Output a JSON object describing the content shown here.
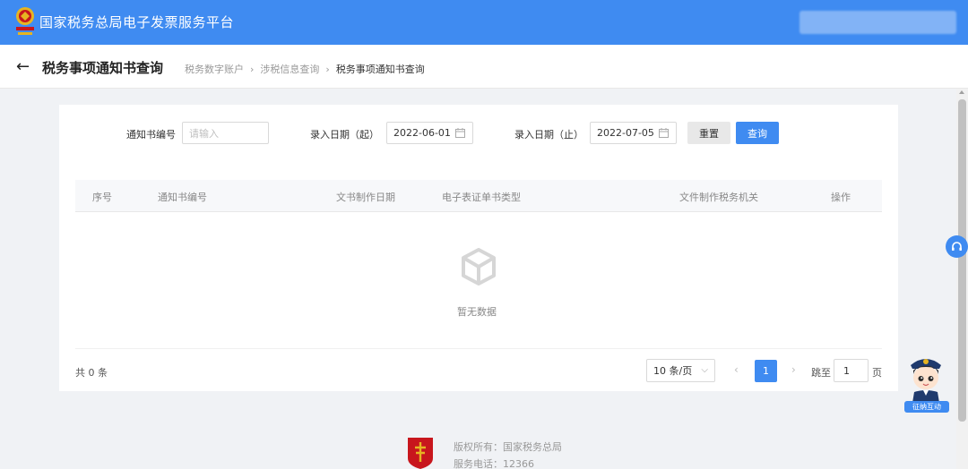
{
  "header": {
    "app_title": "国家税务总局电子发票服务平台"
  },
  "subheader": {
    "page_title": "税务事项通知书查询",
    "breadcrumb": [
      "税务数字账户",
      "涉税信息查询",
      "税务事项通知书查询"
    ]
  },
  "filters": {
    "notice_no_label": "通知书编号",
    "notice_no_placeholder": "请输入",
    "start_label": "录入日期（起）",
    "start_value": "2022-06-01",
    "end_label": "录入日期（止）",
    "end_value": "2022-07-05",
    "reset_label": "重置",
    "query_label": "查询"
  },
  "table": {
    "columns": [
      "序号",
      "通知书编号",
      "文书制作日期",
      "电子表证单书类型",
      "文件制作税务机关",
      "操作"
    ],
    "empty_text": "暂无数据"
  },
  "pagination": {
    "total_text": "共 0 条",
    "page_size": "10 条/页",
    "prev": "‹",
    "current_page": "1",
    "next": "›",
    "jump_label": "跳至",
    "jump_value": "1",
    "page_suffix": "页"
  },
  "floating": {
    "mascot_label": "征纳互动"
  },
  "footer": {
    "copyright": "版权所有：国家税务总局",
    "service_phone": "服务电话：12366"
  },
  "colors": {
    "primary": "#3f8bf1",
    "emblem_red": "#c8161d",
    "emblem_gold": "#e6b422"
  }
}
